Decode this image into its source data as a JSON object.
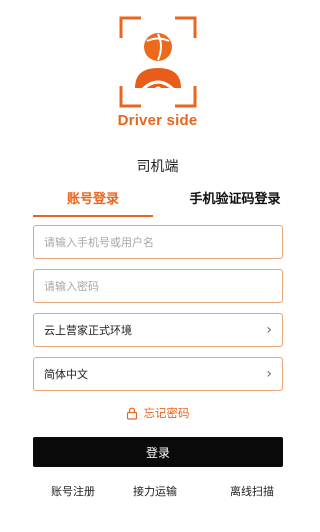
{
  "logo": {
    "icon": "driver-steering-wheel-logo",
    "text": "Driver side",
    "accent": "#E8661E"
  },
  "app_name": "司机端",
  "tabs": [
    {
      "label": "账号登录",
      "active": true
    },
    {
      "label": "手机验证码登录",
      "active": false
    }
  ],
  "form": {
    "username_placeholder": "请输入手机号或用户名",
    "password_placeholder": "请输入密码",
    "environment_value": "云上营家正式环境",
    "language_value": "简体中文"
  },
  "forgot_password": {
    "icon": "lock-icon",
    "label": "忘记密码"
  },
  "login_button": "登录",
  "bottom_links": {
    "register": "账号注册",
    "relay": "接力运输",
    "offline_scan": "离线扫描"
  },
  "colors": {
    "accent": "#E8661E",
    "border": "#E9A577",
    "button_bg": "#0A0A0A"
  }
}
